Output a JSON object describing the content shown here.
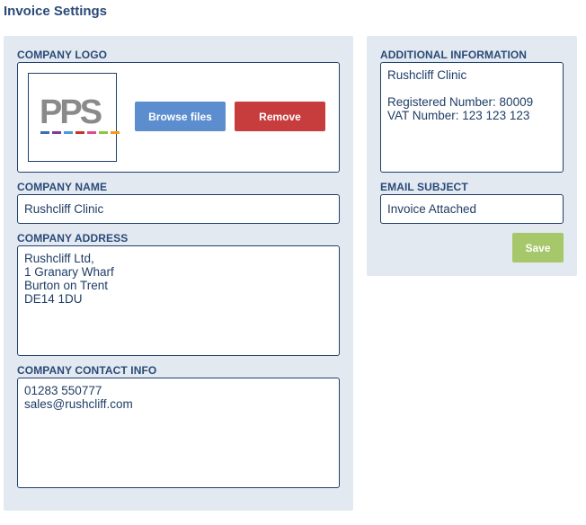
{
  "page": {
    "title": "Invoice Settings"
  },
  "left_panel": {
    "company_logo": {
      "label": "COMPANY LOGO",
      "logo_text": "PPS",
      "logo_bar_colors": [
        "#3b6fb5",
        "#7d3c98",
        "#4a9bd6",
        "#c0392b",
        "#e24a8b",
        "#8cc63f",
        "#f39c12"
      ],
      "browse_label": "Browse files",
      "remove_label": "Remove"
    },
    "company_name": {
      "label": "COMPANY NAME",
      "value": "Rushcliff Clinic"
    },
    "company_address": {
      "label": "COMPANY ADDRESS",
      "value": "Rushcliff Ltd,\n1 Granary Wharf\nBurton on Trent\nDE14 1DU"
    },
    "company_contact": {
      "label": "COMPANY CONTACT INFO",
      "value": "01283 550777\nsales@rushcliff.com"
    }
  },
  "right_panel": {
    "additional_info": {
      "label": "ADDITIONAL INFORMATION",
      "value": "Rushcliff Clinic\n\nRegistered Number: 80009\nVAT Number: 123 123 123"
    },
    "email_subject": {
      "label": "EMAIL SUBJECT",
      "value": "Invoice Attached"
    },
    "save_label": "Save"
  },
  "colors": {
    "panel_bg": "#e3e9f1",
    "border": "#1e3f6e",
    "browse_button": "#5b8dcf",
    "remove_button": "#c73c3c",
    "save_button": "#a6c76a",
    "text": "#1f3d66"
  }
}
